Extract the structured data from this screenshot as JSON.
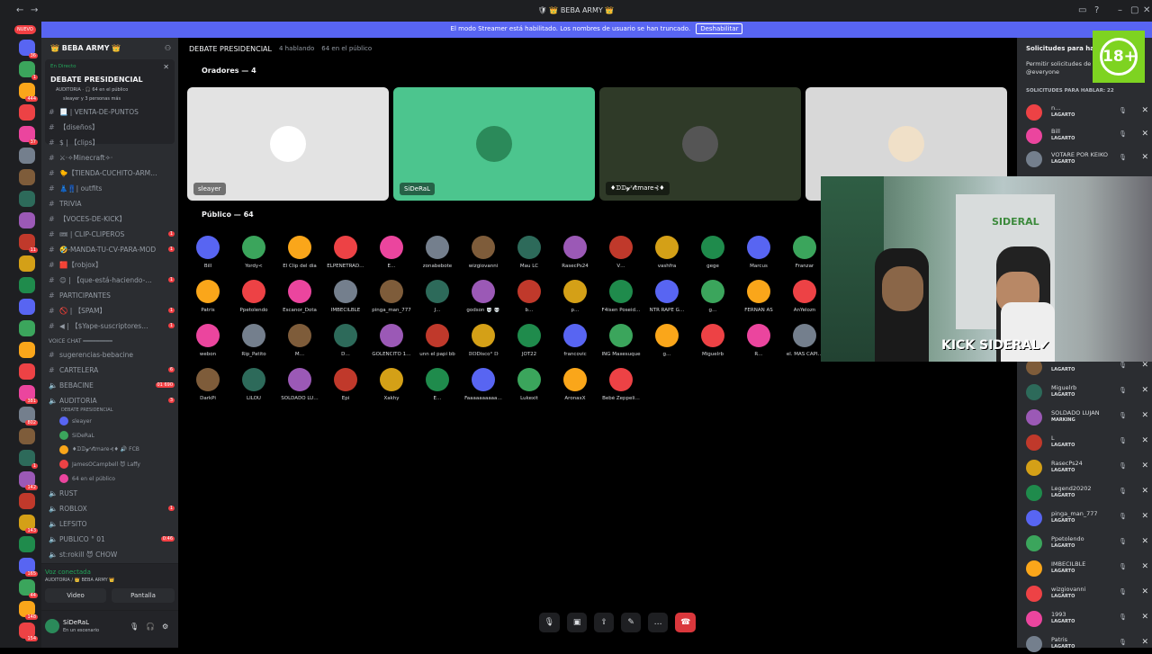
{
  "titlebar": {
    "title": "🛡 👑 BEBA ARMY 👑"
  },
  "banner": {
    "text": "El modo Streamer está habilitado. Los nombres de usuario se han truncado.",
    "button": "Deshabilitar"
  },
  "guilds": {
    "new_badge": "NUEVO",
    "badges": [
      "36",
      "1",
      "444",
      "",
      "37",
      "",
      "",
      "",
      "",
      "11",
      "",
      "",
      "",
      "",
      "",
      "",
      "381",
      "802",
      "",
      "1",
      "142",
      "",
      "143",
      "",
      "165",
      "44",
      "148",
      "154"
    ]
  },
  "server": {
    "name": "👑 BEBA ARMY 👑",
    "live": {
      "label": "En Directo",
      "title": "DEBATE PRESIDENCIAL",
      "sub1": "AUDITORIA · 🎧 64 en el público",
      "sub2": "sleayer y 3 personas más"
    },
    "channels": [
      {
        "name": "📃 | VENTA-DE-PUNTOS",
        "badge": ""
      },
      {
        "name": "【diseños】",
        "badge": ""
      },
      {
        "name": "$ | 【clips】",
        "badge": ""
      },
      {
        "name": "⚔·✧Minecraft✧·",
        "badge": ""
      },
      {
        "name": "🐤【TIENDA-CUCHITO-ARM…",
        "badge": ""
      },
      {
        "name": "👗👖| outfits",
        "badge": ""
      },
      {
        "name": "TRIVIA",
        "badge": ""
      },
      {
        "name": "【VOCES-DE-KICK】",
        "badge": ""
      },
      {
        "name": "🎟 | CLIP-CLIPEROS",
        "badge": "1"
      },
      {
        "name": "🤣-MANDA-TU-CV-PARA-MOD",
        "badge": "1"
      },
      {
        "name": "🟥【robjox】",
        "badge": ""
      },
      {
        "name": "😊 | 【que-está-haciendo-…",
        "badge": "1"
      },
      {
        "name": "PARTICIPANTES",
        "badge": ""
      },
      {
        "name": "🚫 | 【SPAM】",
        "badge": "1"
      },
      {
        "name": "◀ | 【$Yape-suscriptores…",
        "badge": "1"
      }
    ],
    "voice_header": "VOICE CHAT ━━━━━━━━━",
    "channels2": [
      {
        "name": "sugerencias-bebacine",
        "badge": ""
      },
      {
        "name": "CARTELERA",
        "badge": "6"
      },
      {
        "name": "BEBACINE",
        "badge": "01 690"
      },
      {
        "name": "AUDITORIA",
        "badge": "3"
      }
    ],
    "auditoria_sub": "DEBATE PRESIDENCIAL",
    "members": [
      "sleayer",
      "SiDeRaL",
      "♦ᗪᗪ𝔂ᶻ𝓵tmare⊰♦ 🔊 FCB",
      "JamesOCampbell 😈 Laffy",
      "64 en el público"
    ],
    "channels3": [
      {
        "name": "RUST",
        "badge": ""
      },
      {
        "name": "ROBLOX",
        "badge": "1"
      },
      {
        "name": "LEFSITO",
        "badge": ""
      },
      {
        "name": "PUBLICO ° 01",
        "badge": "0:46"
      },
      {
        "name": "st:rokill 😈 CHOW",
        "badge": ""
      }
    ],
    "voice": {
      "status": "Voz conectada",
      "sub": "AUDITORIA / 👑 BEBA ARMY 👑",
      "video": "Video",
      "screen": "Pantalla"
    },
    "user": {
      "name": "SiDeRaL",
      "status": "En un escenario"
    }
  },
  "stage": {
    "title": "DEBATE PRESIDENCIAL",
    "speaking": "4 hablando",
    "audience": "64 en el público",
    "speakers_header": "Oradores — 4",
    "audience_header": "Público — 64"
  },
  "speakers": [
    {
      "name": "sleayer",
      "bg": "#e3e3e3",
      "av": "#ffffff"
    },
    {
      "name": "SiDeRaL",
      "bg": "#4cc58e",
      "av": "#2b8a5a"
    },
    {
      "name": "♦ᗪᗪ𝔂ᶻ𝓵tmare⊰♦",
      "bg": "#2f3a28",
      "av": "#555"
    },
    {
      "name": "",
      "bg": "#d8d8d8",
      "av": "#f0e0c8"
    }
  ],
  "audience": [
    [
      "Bill",
      "Yordy<",
      "El Clip del día",
      "ELPENETRAD…",
      "E…",
      "zonabebote",
      "wizgiovanni",
      "Mau LC",
      "RasecPs24",
      "V…",
      "vashfra",
      "gege",
      "Marcus",
      "Franzar"
    ],
    [
      "Patris",
      "Ppetolendo",
      "Escanor_Dota",
      "IMBECILBLE",
      "pinga_man_777",
      "J…",
      "godson 💀 💀",
      "b…",
      "p…",
      "F4isen Poseid…",
      "NTR RAPE G…",
      "g…",
      "FERNAN AS",
      "AnYelozn"
    ],
    [
      "webon",
      "Rip_Patito",
      "M…",
      "D…",
      "GOLENCITO 1…",
      "unn el papi bb",
      "𝔻𝔻Disco° 𝔻",
      "JOT22",
      "francovic",
      "ING Maxesuque",
      "g…",
      "Miguelrb",
      "R…",
      "el. MAS CAPI…"
    ],
    [
      "DarkPi",
      "LILOU",
      "SOLDADO LU…",
      "Epi",
      "Xakhy",
      "E…",
      "Faaaaaaaaaa…",
      "Lukexit",
      "AronaxX",
      "Bebé Zeppeli…"
    ]
  ],
  "panel": {
    "title": "Solicitudes para hablar",
    "permit": "Permitir solicitudes de",
    "everyone": "@everyone",
    "header": "SOLICITUDES PARA HABLAR: 22",
    "requests": [
      {
        "name": "n…",
        "role": "LAGARTO"
      },
      {
        "name": "Bill",
        "role": "LAGARTO"
      },
      {
        "name": "VOTARE POR KEIKO",
        "role": "LAGARTO"
      },
      {
        "name": "",
        "role": "LAGARTO"
      },
      {
        "name": "Miguelrb",
        "role": "LAGARTO"
      },
      {
        "name": "SOLDADO LUJAN",
        "role": "MARKING"
      },
      {
        "name": "L",
        "role": "LAGARTO"
      },
      {
        "name": "RasecPs24",
        "role": "LAGARTO"
      },
      {
        "name": "Legend20202",
        "role": "LAGARTO"
      },
      {
        "name": "pinga_man_777",
        "role": "LAGARTO"
      },
      {
        "name": "Ppetolendo",
        "role": "LAGARTO"
      },
      {
        "name": "IMBECILBLE",
        "role": "LAGARTO"
      },
      {
        "name": "wizgiovanni",
        "role": "LAGARTO"
      },
      {
        "name": "1993",
        "role": "LAGARTO"
      },
      {
        "name": "Patris",
        "role": "LAGARTO"
      }
    ]
  },
  "overlay": {
    "age": "18+",
    "cam_label": "KICK SIDERAL✔",
    "wall": "SIDERAL"
  }
}
